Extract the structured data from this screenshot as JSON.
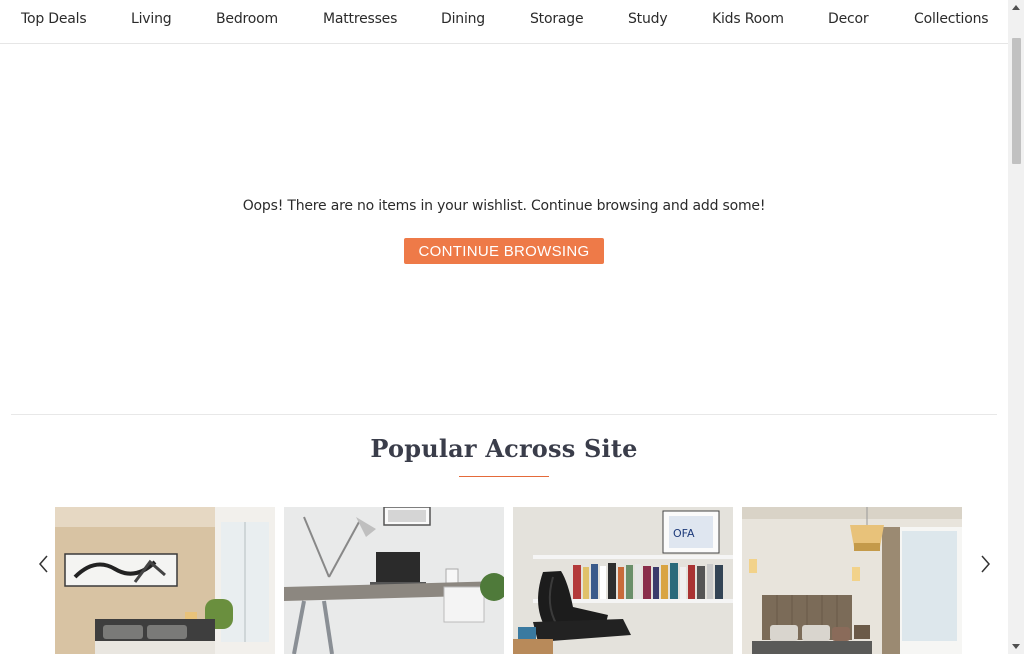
{
  "nav": {
    "items": [
      "Top Deals",
      "Living",
      "Bedroom",
      "Mattresses",
      "Dining",
      "Storage",
      "Study",
      "Kids Room",
      "Decor",
      "Collections"
    ]
  },
  "wishlist": {
    "empty_message": "Oops! There are no items in your wishlist. Continue browsing and add some!",
    "cta_label": "CONTINUE BROWSING"
  },
  "popular": {
    "title": "Popular Across Site",
    "products": [
      {
        "icon": "bedroom-image"
      },
      {
        "icon": "study-desk-image"
      },
      {
        "icon": "lounge-chair-image"
      },
      {
        "icon": "bedroom-suite-image"
      }
    ]
  },
  "colors": {
    "accent": "#ee7a48",
    "underline": "#e46a3a",
    "title": "#3a3d4a"
  }
}
